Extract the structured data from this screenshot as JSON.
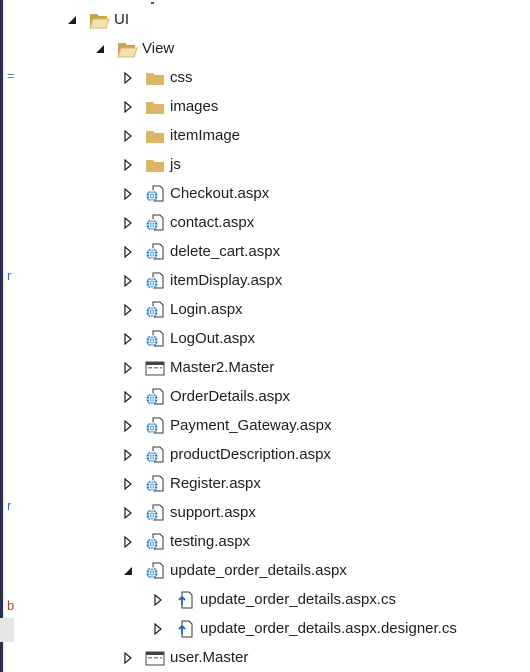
{
  "tree": {
    "root": {
      "label": "UI",
      "icon": "folder-open-icon",
      "expanded": true
    },
    "view": {
      "label": "View",
      "icon": "folder-open-icon",
      "expanded": true
    },
    "items": [
      {
        "label": "css",
        "icon": "folder-icon",
        "expanded": false
      },
      {
        "label": "images",
        "icon": "folder-icon",
        "expanded": false
      },
      {
        "label": "itemImage",
        "icon": "folder-icon",
        "expanded": false
      },
      {
        "label": "js",
        "icon": "folder-icon",
        "expanded": false
      },
      {
        "label": "Checkout.aspx",
        "icon": "aspx-file-icon",
        "expanded": false
      },
      {
        "label": "contact.aspx",
        "icon": "aspx-file-icon",
        "expanded": false
      },
      {
        "label": "delete_cart.aspx",
        "icon": "aspx-file-icon",
        "expanded": false
      },
      {
        "label": "itemDisplay.aspx",
        "icon": "aspx-file-icon",
        "expanded": false
      },
      {
        "label": "Login.aspx",
        "icon": "aspx-file-icon",
        "expanded": false
      },
      {
        "label": "LogOut.aspx",
        "icon": "aspx-file-icon",
        "expanded": false
      },
      {
        "label": "Master2.Master",
        "icon": "master-page-icon",
        "expanded": false
      },
      {
        "label": "OrderDetails.aspx",
        "icon": "aspx-file-icon",
        "expanded": false
      },
      {
        "label": "Payment_Gateway.aspx",
        "icon": "aspx-file-icon",
        "expanded": false
      },
      {
        "label": "productDescription.aspx",
        "icon": "aspx-file-icon",
        "expanded": false
      },
      {
        "label": "Register.aspx",
        "icon": "aspx-file-icon",
        "expanded": false
      },
      {
        "label": "support.aspx",
        "icon": "aspx-file-icon",
        "expanded": false
      },
      {
        "label": "testing.aspx",
        "icon": "aspx-file-icon",
        "expanded": false
      },
      {
        "label": "update_order_details.aspx",
        "icon": "aspx-file-icon",
        "expanded": true
      },
      {
        "label": "update_order_details.aspx.cs",
        "icon": "cs-file-icon",
        "expanded": false
      },
      {
        "label": "update_order_details.aspx.designer.cs",
        "icon": "cs-file-icon",
        "expanded": false
      },
      {
        "label": "user.Master",
        "icon": "master-page-icon",
        "expanded": false
      }
    ]
  },
  "gutter": {
    "marks": [
      "=",
      "r",
      "r",
      "b"
    ]
  },
  "colors": {
    "folder": "#dcb567",
    "aspx_globe": "#1e7bc4",
    "arrow": "#1e1e1e",
    "bar": "#2b2f4a"
  }
}
